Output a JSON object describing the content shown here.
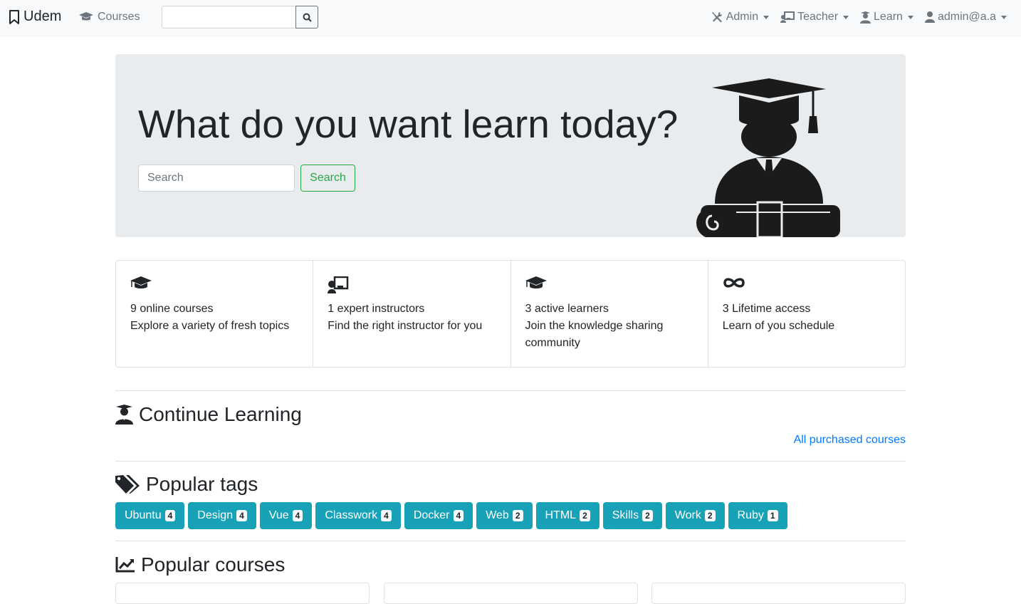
{
  "navbar": {
    "brand": "Udem",
    "courses_label": "Courses",
    "search_value": "",
    "menus": [
      {
        "label": "Admin",
        "icon": "tools-icon"
      },
      {
        "label": "Teacher",
        "icon": "chalkboard-teacher-icon"
      },
      {
        "label": "Learn",
        "icon": "user-graduate-icon"
      },
      {
        "label": "admin@a.a",
        "icon": "user-icon"
      }
    ]
  },
  "hero": {
    "title": "What do you want learn today?",
    "search_placeholder": "Search",
    "search_button": "Search"
  },
  "stats": [
    {
      "icon": "graduation-cap-icon",
      "line1": "9 online courses",
      "line2": "Explore a variety of fresh topics"
    },
    {
      "icon": "chalkboard-teacher-icon",
      "line1": "1 expert instructors",
      "line2": "Find the right instructor for you"
    },
    {
      "icon": "graduation-cap-icon",
      "line1": "3 active learners",
      "line2": "Join the knowledge sharing community"
    },
    {
      "icon": "infinity-icon",
      "line1": "3 Lifetime access",
      "line2": "Learn of you schedule"
    }
  ],
  "continue_learning": {
    "title": "Continue Learning",
    "link": "All purchased courses"
  },
  "popular_tags": {
    "title": "Popular tags",
    "tags": [
      {
        "name": "Ubuntu",
        "count": "4"
      },
      {
        "name": "Design",
        "count": "4"
      },
      {
        "name": "Vue",
        "count": "4"
      },
      {
        "name": "Classwork",
        "count": "4"
      },
      {
        "name": "Docker",
        "count": "4"
      },
      {
        "name": "Web",
        "count": "2"
      },
      {
        "name": "HTML",
        "count": "2"
      },
      {
        "name": "Skills",
        "count": "2"
      },
      {
        "name": "Work",
        "count": "2"
      },
      {
        "name": "Ruby",
        "count": "1"
      }
    ]
  },
  "popular_courses": {
    "title": "Popular courses"
  },
  "colors": {
    "navbar_bg": "#f8f9fa",
    "hero_bg": "#e9ecef",
    "tag_bg": "#17a2b8",
    "success": "#28a745",
    "link": "#007bff"
  }
}
